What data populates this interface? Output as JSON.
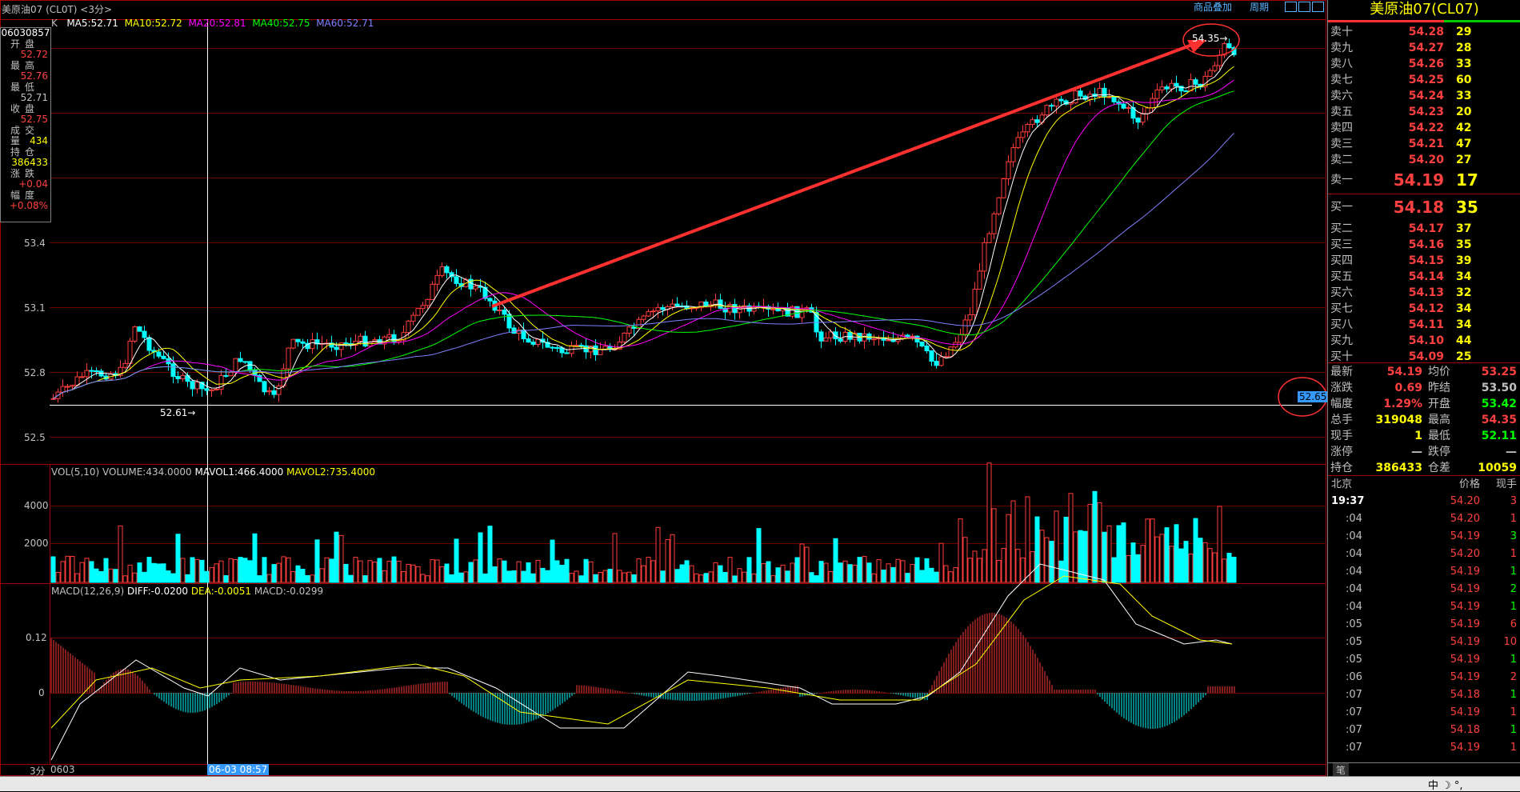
{
  "window_title": "美原油07 (CL0T) <3分>",
  "toolbar": {
    "overlay_label": "商品叠加",
    "period_label": "周期"
  },
  "ma_legend": {
    "k": "K",
    "ma5": "MA5:52.71",
    "ma10": "MA10:52.72",
    "ma20": "MA20:52.81",
    "ma40": "MA40:52.75",
    "ma60": "MA60:52.71"
  },
  "info_box": {
    "date": "06030857",
    "rows": [
      {
        "label": "开盘",
        "value": "52.72",
        "color": "#ff4040"
      },
      {
        "label": "最高",
        "value": "52.76",
        "color": "#ff4040"
      },
      {
        "label": "最低",
        "value": "52.71",
        "color": "#c0c0c0"
      },
      {
        "label": "收盘",
        "value": "52.75",
        "color": "#ff4040"
      },
      {
        "label": "成交量",
        "value": "434",
        "color": "#ffff00"
      },
      {
        "label": "持仓",
        "value": "386433",
        "color": "#ffff00"
      },
      {
        "label": "涨跌",
        "value": "+0.04",
        "color": "#ff4040"
      },
      {
        "label": "幅度",
        "value": "+0.08%",
        "color": "#ff4040"
      }
    ]
  },
  "price_axis": [
    "53.4",
    "53.1",
    "52.8",
    "52.5"
  ],
  "annotations": {
    "high_label": "54.35",
    "low_label": "52.61",
    "current_price_tag": "52.65"
  },
  "vol_legend": {
    "title": "VOL(5,10)",
    "volume": "VOLUME:434.0000",
    "mavol1": "MAVOL1:466.4000",
    "mavol2": "MAVOL2:735.4000"
  },
  "vol_axis": [
    "4000",
    "2000"
  ],
  "macd_legend": {
    "title": "MACD(12,26,9)",
    "diff": "DIFF:-0.0200",
    "dea": "DEA:-0.0051",
    "macd": "MACD:-0.0299"
  },
  "macd_axis": [
    "0.12",
    "0"
  ],
  "time_axis": {
    "period": "3分",
    "start": "0603",
    "cursor": "06-03 08:57"
  },
  "quote": {
    "title": "美原油07(CL07)",
    "asks": [
      {
        "label": "卖十",
        "price": "54.28",
        "vol": "29"
      },
      {
        "label": "卖九",
        "price": "54.27",
        "vol": "28"
      },
      {
        "label": "卖八",
        "price": "54.26",
        "vol": "33"
      },
      {
        "label": "卖七",
        "price": "54.25",
        "vol": "60"
      },
      {
        "label": "卖六",
        "price": "54.24",
        "vol": "33"
      },
      {
        "label": "卖五",
        "price": "54.23",
        "vol": "20"
      },
      {
        "label": "卖四",
        "price": "54.22",
        "vol": "42"
      },
      {
        "label": "卖三",
        "price": "54.21",
        "vol": "47"
      },
      {
        "label": "卖二",
        "price": "54.20",
        "vol": "27"
      }
    ],
    "ask1": {
      "label": "卖一",
      "price": "54.19",
      "vol": "17"
    },
    "bid1": {
      "label": "买一",
      "price": "54.18",
      "vol": "35"
    },
    "bids": [
      {
        "label": "买二",
        "price": "54.17",
        "vol": "37"
      },
      {
        "label": "买三",
        "price": "54.16",
        "vol": "35"
      },
      {
        "label": "买四",
        "price": "54.15",
        "vol": "39"
      },
      {
        "label": "买五",
        "price": "54.14",
        "vol": "34"
      },
      {
        "label": "买六",
        "price": "54.13",
        "vol": "32"
      },
      {
        "label": "买七",
        "price": "54.12",
        "vol": "34"
      },
      {
        "label": "买八",
        "price": "54.11",
        "vol": "34"
      },
      {
        "label": "买九",
        "price": "54.10",
        "vol": "44"
      },
      {
        "label": "买十",
        "price": "54.09",
        "vol": "25"
      }
    ],
    "stats": [
      {
        "l1": "最新",
        "v1": "54.19",
        "c1": "#ff4040",
        "l2": "均价",
        "v2": "53.25",
        "c2": "#ff4040"
      },
      {
        "l1": "涨跌",
        "v1": "0.69",
        "c1": "#ff4040",
        "l2": "昨结",
        "v2": "53.50",
        "c2": "#c0c0c0"
      },
      {
        "l1": "幅度",
        "v1": "1.29%",
        "c1": "#ff4040",
        "l2": "开盘",
        "v2": "53.42",
        "c2": "#00ff00"
      },
      {
        "l1": "总手",
        "v1": "319048",
        "c1": "#ffff00",
        "l2": "最高",
        "v2": "54.35",
        "c2": "#ff4040"
      },
      {
        "l1": "现手",
        "v1": "1",
        "c1": "#ffff00",
        "l2": "最低",
        "v2": "52.11",
        "c2": "#00ff00"
      },
      {
        "l1": "涨停",
        "v1": "—",
        "c1": "#c0c0c0",
        "l2": "跌停",
        "v2": "—",
        "c2": "#c0c0c0"
      },
      {
        "l1": "持仓",
        "v1": "386433",
        "c1": "#ffff00",
        "l2": "仓差",
        "v2": "10059",
        "c2": "#ffff00"
      }
    ],
    "ticks_header": {
      "time": "北京",
      "price": "价格",
      "vol": "现手"
    },
    "ticks": [
      {
        "time": "19:37",
        "price": "54.20",
        "vol": "3",
        "vc": "#ff4040"
      },
      {
        "time": ":04",
        "price": "54.20",
        "vol": "1",
        "vc": "#ff4040"
      },
      {
        "time": ":04",
        "price": "54.19",
        "vol": "3",
        "vc": "#00ff00"
      },
      {
        "time": ":04",
        "price": "54.20",
        "vol": "1",
        "vc": "#ff4040"
      },
      {
        "time": ":04",
        "price": "54.19",
        "vol": "1",
        "vc": "#00ff00"
      },
      {
        "time": ":04",
        "price": "54.19",
        "vol": "2",
        "vc": "#00ff00"
      },
      {
        "time": ":04",
        "price": "54.19",
        "vol": "1",
        "vc": "#00ff00"
      },
      {
        "time": ":05",
        "price": "54.19",
        "vol": "6",
        "vc": "#ff4040"
      },
      {
        "time": ":05",
        "price": "54.19",
        "vol": "10",
        "vc": "#ff4040"
      },
      {
        "time": ":05",
        "price": "54.19",
        "vol": "1",
        "vc": "#00ff00"
      },
      {
        "time": ":06",
        "price": "54.19",
        "vol": "2",
        "vc": "#ff4040"
      },
      {
        "time": ":07",
        "price": "54.18",
        "vol": "1",
        "vc": "#00ff00"
      },
      {
        "time": ":07",
        "price": "54.19",
        "vol": "1",
        "vc": "#ff4040"
      },
      {
        "time": ":07",
        "price": "54.18",
        "vol": "1",
        "vc": "#00ff00"
      },
      {
        "time": ":07",
        "price": "54.19",
        "vol": "1",
        "vc": "#ff4040"
      }
    ],
    "footer_tab": "笔"
  },
  "taskbar": {
    "ime": "中 ☽ °,"
  }
}
